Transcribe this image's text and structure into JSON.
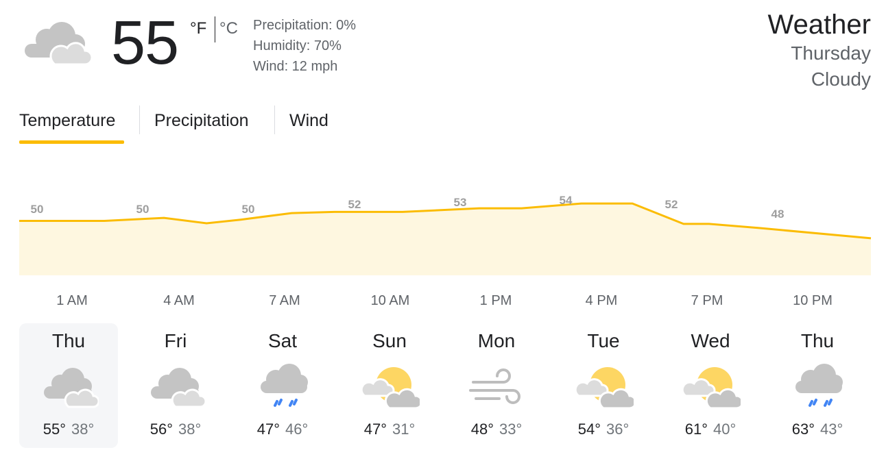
{
  "current": {
    "icon": "cloudy-icon",
    "temperature": "55",
    "unit_f": "°F",
    "unit_c": "°C",
    "precipitation": "Precipitation: 0%",
    "humidity": "Humidity: 70%",
    "wind": "Wind: 12 mph"
  },
  "header": {
    "title": "Weather",
    "day": "Thursday",
    "condition": "Cloudy"
  },
  "tabs": [
    {
      "label": "Temperature",
      "active": true
    },
    {
      "label": "Precipitation",
      "active": false
    },
    {
      "label": "Wind",
      "active": false
    }
  ],
  "colors": {
    "accent": "#fbbc04",
    "chart_fill": "#fef7e0",
    "sun": "#fdd663",
    "rain": "#4285f4"
  },
  "chart_data": {
    "type": "area",
    "x": [
      "1 AM",
      "4 AM",
      "7 AM",
      "10 AM",
      "1 PM",
      "4 PM",
      "7 PM",
      "10 PM"
    ],
    "labels": [
      "50",
      "50",
      "50",
      "52",
      "53",
      "54",
      "52",
      "48"
    ],
    "values": [
      50,
      50,
      50.5,
      49.6,
      50.2,
      51.3,
      51.5,
      51.5,
      52.1,
      52.1,
      52.9,
      52.9,
      49.5,
      49.5,
      48.8,
      47.1
    ],
    "sample_x_fraction": [
      0,
      0.1,
      0.17,
      0.22,
      0.26,
      0.32,
      0.37,
      0.45,
      0.54,
      0.59,
      0.66,
      0.72,
      0.78,
      0.81,
      0.87,
      1
    ],
    "grid": false
  },
  "times": [
    "1 AM",
    "4 AM",
    "7 AM",
    "10 AM",
    "1 PM",
    "4 PM",
    "7 PM",
    "10 PM"
  ],
  "forecast": [
    {
      "day": "Thu",
      "icon": "cloudy-icon",
      "high": "55°",
      "low": "38°",
      "selected": true
    },
    {
      "day": "Fri",
      "icon": "cloudy-icon",
      "high": "56°",
      "low": "38°",
      "selected": false
    },
    {
      "day": "Sat",
      "icon": "rain-icon",
      "high": "47°",
      "low": "46°",
      "selected": false
    },
    {
      "day": "Sun",
      "icon": "partly-cloudy-icon",
      "high": "47°",
      "low": "31°",
      "selected": false
    },
    {
      "day": "Mon",
      "icon": "wind-icon",
      "high": "48°",
      "low": "33°",
      "selected": false
    },
    {
      "day": "Tue",
      "icon": "partly-cloudy-icon",
      "high": "54°",
      "low": "36°",
      "selected": false
    },
    {
      "day": "Wed",
      "icon": "partly-cloudy-icon",
      "high": "61°",
      "low": "40°",
      "selected": false
    },
    {
      "day": "Thu",
      "icon": "rain-icon",
      "high": "63°",
      "low": "43°",
      "selected": false
    }
  ]
}
